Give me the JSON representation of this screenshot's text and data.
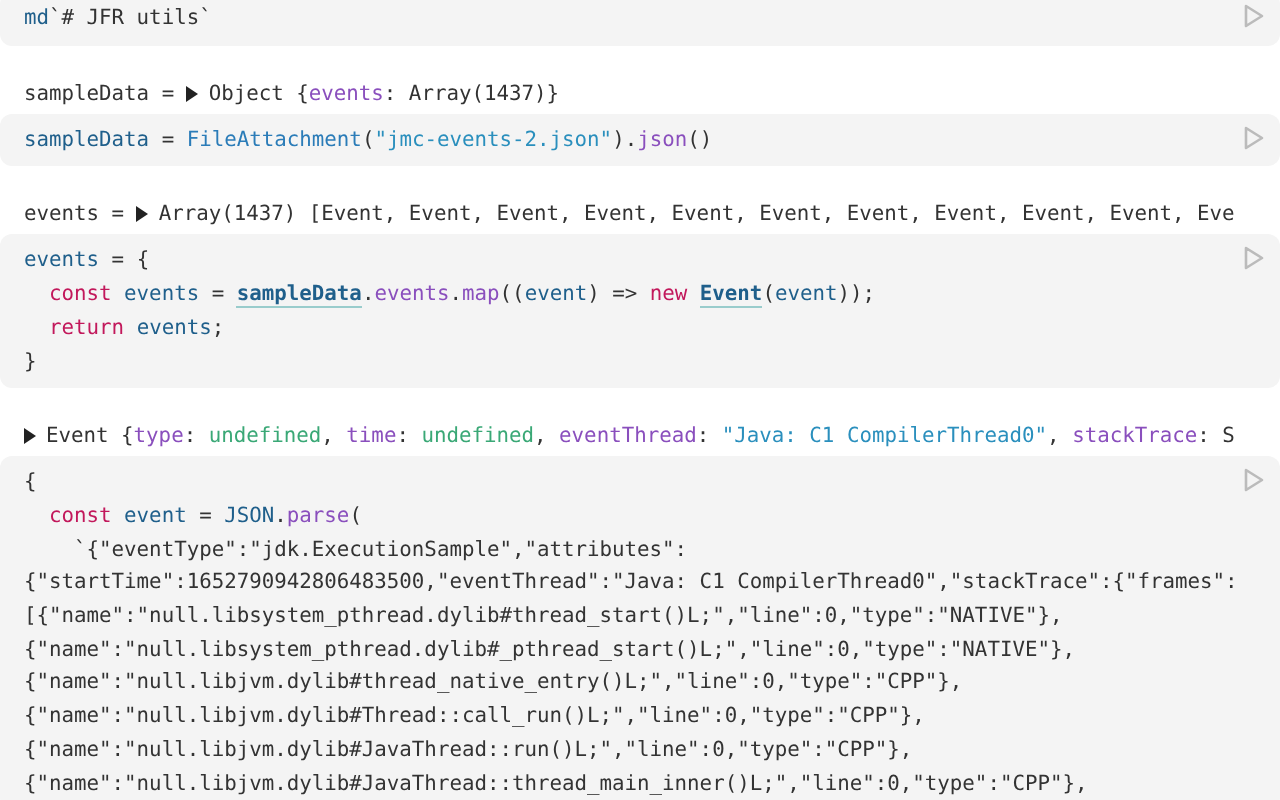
{
  "cells": [
    {
      "code": [
        [
          {
            "text": "md",
            "kind": "var"
          },
          {
            "text": "`# JFR utils`",
            "kind": "plain"
          }
        ]
      ]
    },
    {
      "output": [
        {
          "text": "sampleData = ",
          "kind": "plain"
        },
        {
          "kind": "toggle",
          "expanded": false
        },
        {
          "text": "Object {",
          "kind": "plain"
        },
        {
          "text": "events",
          "kind": "member"
        },
        {
          "text": ": Array(1437)}",
          "kind": "plain"
        }
      ],
      "code": [
        [
          {
            "text": "sampleData",
            "kind": "var"
          },
          {
            "text": " = ",
            "kind": "plain"
          },
          {
            "text": "FileAttachment",
            "kind": "func"
          },
          {
            "text": "(",
            "kind": "plain"
          },
          {
            "text": "\"jmc-events-2.json\"",
            "kind": "string"
          },
          {
            "text": ").",
            "kind": "plain"
          },
          {
            "text": "json",
            "kind": "member"
          },
          {
            "text": "()",
            "kind": "plain"
          }
        ]
      ]
    },
    {
      "output": [
        {
          "text": "events = ",
          "kind": "plain"
        },
        {
          "kind": "toggle",
          "expanded": false
        },
        {
          "text": "Array(1437) [Event, Event, Event, Event, Event, Event, Event, Event, Event, Event, Eve",
          "kind": "plain"
        }
      ],
      "code": [
        [
          {
            "text": "events",
            "kind": "var"
          },
          {
            "text": " = {",
            "kind": "plain"
          }
        ],
        [
          {
            "text": "  const ",
            "kind": "keyword"
          },
          {
            "text": "events",
            "kind": "var"
          },
          {
            "text": " = ",
            "kind": "plain"
          },
          {
            "text": "sampleData",
            "kind": "ref"
          },
          {
            "text": ".",
            "kind": "plain"
          },
          {
            "text": "events",
            "kind": "member"
          },
          {
            "text": ".",
            "kind": "plain"
          },
          {
            "text": "map",
            "kind": "member"
          },
          {
            "text": "((",
            "kind": "plain"
          },
          {
            "text": "event",
            "kind": "var"
          },
          {
            "text": ") => ",
            "kind": "plain"
          },
          {
            "text": "new ",
            "kind": "keyword"
          },
          {
            "text": "Event",
            "kind": "ref"
          },
          {
            "text": "(",
            "kind": "plain"
          },
          {
            "text": "event",
            "kind": "var"
          },
          {
            "text": "));",
            "kind": "plain"
          }
        ],
        [
          {
            "text": "  return ",
            "kind": "keyword"
          },
          {
            "text": "events",
            "kind": "var"
          },
          {
            "text": ";",
            "kind": "plain"
          }
        ],
        [
          {
            "text": "}",
            "kind": "plain"
          }
        ]
      ]
    },
    {
      "output": [
        {
          "kind": "toggle",
          "expanded": false
        },
        {
          "text": "Event {",
          "kind": "plain"
        },
        {
          "text": "type",
          "kind": "member"
        },
        {
          "text": ": ",
          "kind": "plain"
        },
        {
          "text": "undefined",
          "kind": "undef"
        },
        {
          "text": ", ",
          "kind": "plain"
        },
        {
          "text": "time",
          "kind": "member"
        },
        {
          "text": ": ",
          "kind": "plain"
        },
        {
          "text": "undefined",
          "kind": "undef"
        },
        {
          "text": ", ",
          "kind": "plain"
        },
        {
          "text": "eventThread",
          "kind": "member"
        },
        {
          "text": ": ",
          "kind": "plain"
        },
        {
          "text": "\"Java: C1 CompilerThread0\"",
          "kind": "string"
        },
        {
          "text": ", ",
          "kind": "plain"
        },
        {
          "text": "stackTrace",
          "kind": "member"
        },
        {
          "text": ": S",
          "kind": "plain"
        }
      ],
      "code": [
        [
          {
            "text": "{",
            "kind": "plain"
          }
        ],
        [
          {
            "text": "  const ",
            "kind": "keyword"
          },
          {
            "text": "event",
            "kind": "var"
          },
          {
            "text": " = ",
            "kind": "plain"
          },
          {
            "text": "JSON",
            "kind": "var"
          },
          {
            "text": ".",
            "kind": "plain"
          },
          {
            "text": "parse",
            "kind": "member"
          },
          {
            "text": "(",
            "kind": "plain"
          }
        ],
        [
          {
            "text": "    `{\"eventType\":\"jdk.ExecutionSample\",\"attributes\":",
            "kind": "plain"
          }
        ],
        [
          {
            "text": "{\"startTime\":1652790942806483500,\"eventThread\":\"Java: C1 CompilerThread0\",\"stackTrace\":{\"frames\":",
            "kind": "plain"
          }
        ],
        [
          {
            "text": "[{\"name\":\"null.libsystem_pthread.dylib#thread_start()L;\",\"line\":0,\"type\":\"NATIVE\"},",
            "kind": "plain"
          }
        ],
        [
          {
            "text": "{\"name\":\"null.libsystem_pthread.dylib#_pthread_start()L;\",\"line\":0,\"type\":\"NATIVE\"},",
            "kind": "plain"
          }
        ],
        [
          {
            "text": "{\"name\":\"null.libjvm.dylib#thread_native_entry()L;\",\"line\":0,\"type\":\"CPP\"},",
            "kind": "plain"
          }
        ],
        [
          {
            "text": "{\"name\":\"null.libjvm.dylib#Thread::call_run()L;\",\"line\":0,\"type\":\"CPP\"},",
            "kind": "plain"
          }
        ],
        [
          {
            "text": "{\"name\":\"null.libjvm.dylib#JavaThread::run()L;\",\"line\":0,\"type\":\"CPP\"},",
            "kind": "plain"
          }
        ],
        [
          {
            "text": "{\"name\":\"null.libjvm.dylib#JavaThread::thread_main_inner()L;\",\"line\":0,\"type\":\"CPP\"},",
            "kind": "plain"
          }
        ]
      ]
    }
  ]
}
